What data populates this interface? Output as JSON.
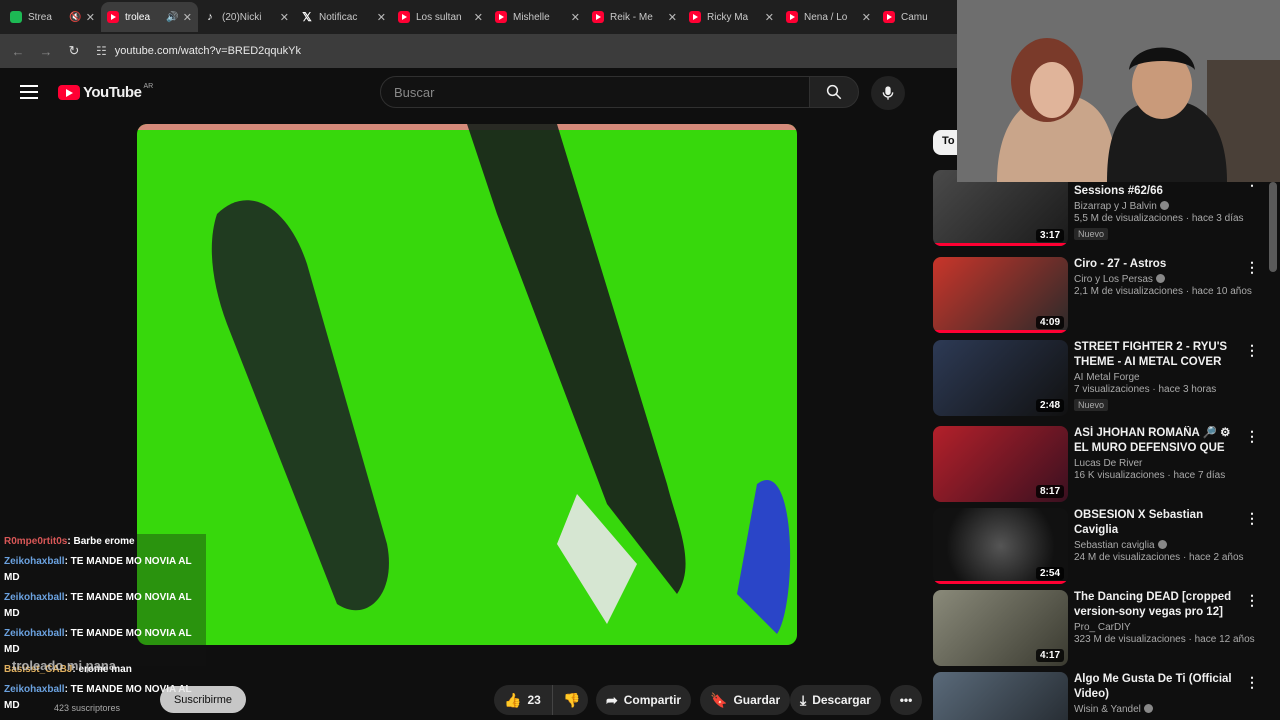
{
  "browser": {
    "tabs": [
      {
        "label": "Strea",
        "icon": "streamlabs-icon"
      },
      {
        "label": "trolea",
        "icon": "youtube-icon",
        "active": true
      },
      {
        "label": "(20)Nicki",
        "icon": "tiktok-icon"
      },
      {
        "label": "Notificac",
        "icon": "x-icon"
      },
      {
        "label": "Los sultan",
        "icon": "youtube-icon"
      },
      {
        "label": "Mishelle",
        "icon": "youtube-icon"
      },
      {
        "label": "Reik - Me",
        "icon": "youtube-icon"
      },
      {
        "label": "Ricky Ma",
        "icon": "youtube-icon"
      },
      {
        "label": "Nena / Lo",
        "icon": "youtube-icon"
      },
      {
        "label": "Camu",
        "icon": "youtube-icon"
      }
    ],
    "url": "youtube.com/watch?v=BRED2qqukYk"
  },
  "youtube": {
    "logo_text": "YouTube",
    "country_code": "AR",
    "search_placeholder": "Buscar",
    "chip_label": "To"
  },
  "chat": [
    {
      "user": "R0mpe0rtit0s",
      "text": ": Barbe erome",
      "color": "#d85757"
    },
    {
      "user": "Zeikohaxball",
      "text": ": TE MANDE MO NOVIA AL MD",
      "color": "#6ba2e0"
    },
    {
      "user": "Zeikohaxball",
      "text": ": TE MANDE MO NOVIA AL MD",
      "color": "#6ba2e0"
    },
    {
      "user": "Zeikohaxball",
      "text": ": TE MANDE MO NOVIA AL MD",
      "color": "#6ba2e0"
    },
    {
      "user": "Basisst_CABJ",
      "text": ": erome man",
      "color": "#e0b060"
    },
    {
      "user": "Zeikohaxball",
      "text": ": TE MANDE MO NOVIA AL MD",
      "color": "#6ba2e0"
    }
  ],
  "overlay_text": "troleado mi pana",
  "channel": {
    "subscribers": "423 suscriptores",
    "subscribe_label": "Suscribirme"
  },
  "actions": {
    "likes": "23",
    "share": "Compartir",
    "save": "Guardar",
    "download": "Descargar"
  },
  "recommendations": [
    {
      "title": "Sessions #62/66",
      "channel": "Bizarrap y J Balvin",
      "meta": "5,5 M de visualizaciones · hace 3 días",
      "badge": "Nuevo",
      "duration": "3:17",
      "progress": true
    },
    {
      "title": "Ciro - 27 - Astros",
      "channel": "Ciro y Los Persas",
      "meta": "2,1 M de visualizaciones · hace 10 años",
      "badge": "",
      "duration": "4:09",
      "progress": true
    },
    {
      "title": "STREET FIGHTER 2 - RYU'S THEME - AI METAL COVER",
      "channel": "AI Metal Forge",
      "meta": "7 visualizaciones · hace 3 horas",
      "badge": "Nuevo",
      "duration": "2:48",
      "progress": false
    },
    {
      "title": "ASÍ JHOHAN ROMAÑA 🔎 ⚙ EL MURO DEFENSIVO QUE ...",
      "channel": "Lucas De River",
      "meta": "16 K visualizaciones · hace 7 días",
      "badge": "",
      "duration": "8:17",
      "progress": false
    },
    {
      "title": "OBSESION X Sebastian Caviglia",
      "channel": "Sebastian caviglia",
      "meta": "24 M de visualizaciones · hace 2 años",
      "badge": "",
      "duration": "2:54",
      "progress": true
    },
    {
      "title": "The Dancing DEAD [cropped version-sony vegas pro 12]",
      "channel": "Pro_ CarDIY",
      "meta": "323 M de visualizaciones · hace 12 años",
      "badge": "",
      "duration": "4:17",
      "progress": false
    },
    {
      "title": "Algo Me Gusta De Ti (Official Video)",
      "channel": "Wisin & Yandel",
      "meta": "",
      "badge": "",
      "duration": "",
      "progress": false
    }
  ]
}
